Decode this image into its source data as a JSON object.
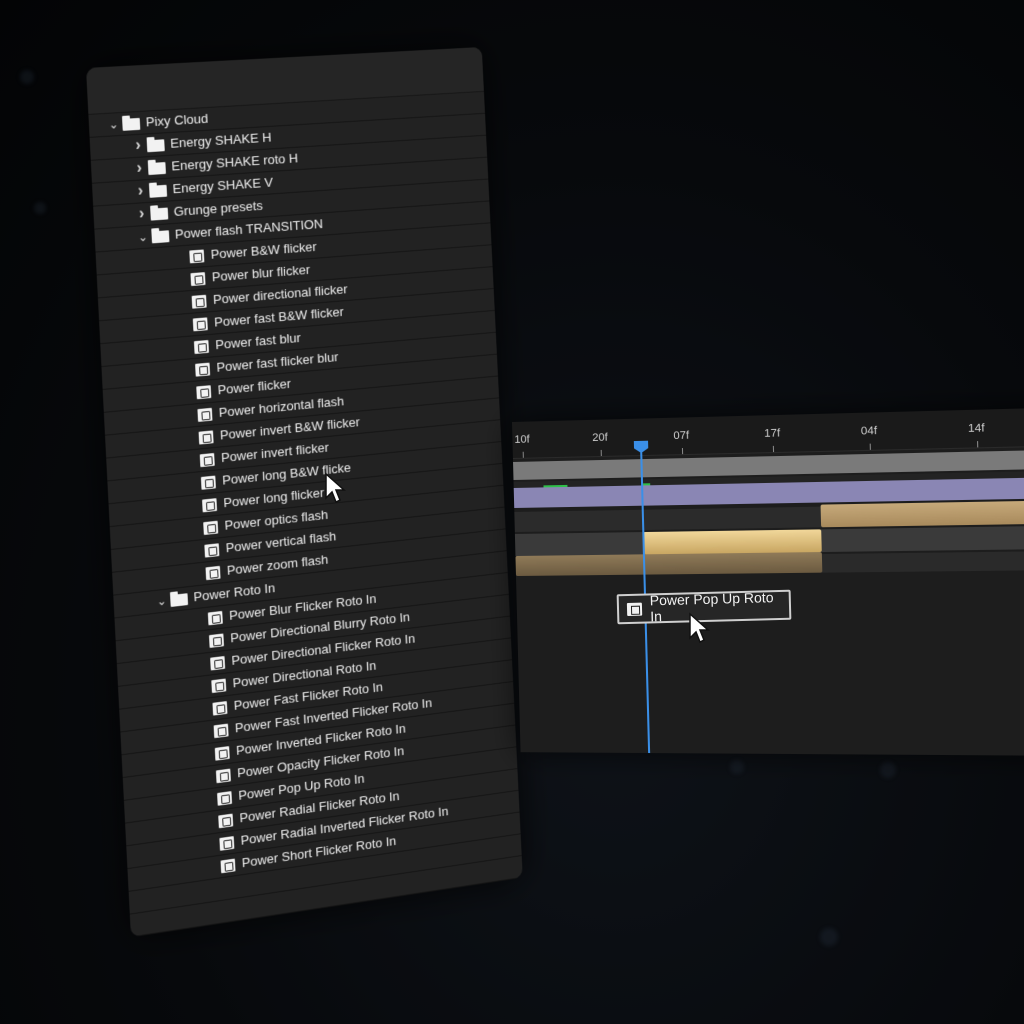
{
  "presets_panel": {
    "items": [
      {
        "label": "Pixy Cloud",
        "kind": "folder",
        "depth": 0,
        "expanded": true
      },
      {
        "label": "Energy SHAKE H",
        "kind": "folder",
        "depth": 1,
        "expanded": false
      },
      {
        "label": "Energy SHAKE roto H",
        "kind": "folder",
        "depth": 1,
        "expanded": false
      },
      {
        "label": "Energy SHAKE V",
        "kind": "folder",
        "depth": 1,
        "expanded": false
      },
      {
        "label": "Grunge presets",
        "kind": "folder",
        "depth": 1,
        "expanded": false
      },
      {
        "label": "Power flash TRANSITION",
        "kind": "folder",
        "depth": 1,
        "expanded": true
      },
      {
        "label": "Power B&W flicker",
        "kind": "preset",
        "depth": 2
      },
      {
        "label": "Power blur flicker",
        "kind": "preset",
        "depth": 2
      },
      {
        "label": "Power directional flicker",
        "kind": "preset",
        "depth": 2
      },
      {
        "label": "Power fast B&W flicker",
        "kind": "preset",
        "depth": 2
      },
      {
        "label": "Power fast blur",
        "kind": "preset",
        "depth": 2
      },
      {
        "label": "Power fast flicker blur",
        "kind": "preset",
        "depth": 2
      },
      {
        "label": "Power flicker",
        "kind": "preset",
        "depth": 2
      },
      {
        "label": "Power horizontal flash",
        "kind": "preset",
        "depth": 2
      },
      {
        "label": "Power invert B&W flicker",
        "kind": "preset",
        "depth": 2
      },
      {
        "label": "Power invert flicker",
        "kind": "preset",
        "depth": 2
      },
      {
        "label": "Power long B&W flicke",
        "kind": "preset",
        "depth": 2
      },
      {
        "label": "Power long flicker",
        "kind": "preset",
        "depth": 2
      },
      {
        "label": "Power optics flash",
        "kind": "preset",
        "depth": 2
      },
      {
        "label": "Power vertical flash",
        "kind": "preset",
        "depth": 2
      },
      {
        "label": "Power zoom flash",
        "kind": "preset",
        "depth": 2
      },
      {
        "label": "Power Roto In",
        "kind": "folder",
        "depth": 1,
        "expanded": true
      },
      {
        "label": "Power Blur Flicker Roto In",
        "kind": "preset",
        "depth": 2
      },
      {
        "label": "Power Directional Blurry Roto In",
        "kind": "preset",
        "depth": 2
      },
      {
        "label": "Power Directional Flicker Roto In",
        "kind": "preset",
        "depth": 2
      },
      {
        "label": "Power Directional Roto In",
        "kind": "preset",
        "depth": 2
      },
      {
        "label": "Power Fast Flicker Roto In",
        "kind": "preset",
        "depth": 2
      },
      {
        "label": "Power Fast Inverted Flicker Roto In",
        "kind": "preset",
        "depth": 2
      },
      {
        "label": "Power Inverted Flicker Roto In",
        "kind": "preset",
        "depth": 2
      },
      {
        "label": "Power Opacity Flicker Roto In",
        "kind": "preset",
        "depth": 2
      },
      {
        "label": "Power Pop Up Roto In",
        "kind": "preset",
        "depth": 2
      },
      {
        "label": "Power Radial Flicker Roto In",
        "kind": "preset",
        "depth": 2
      },
      {
        "label": "Power Radial Inverted Flicker Roto In",
        "kind": "preset",
        "depth": 2
      },
      {
        "label": "Power Short Flicker Roto In",
        "kind": "preset",
        "depth": 2
      }
    ],
    "icons": {
      "folder": "folder-icon",
      "preset": "animation-preset-icon",
      "collapsed": "chevron-right-icon",
      "expanded": "chevron-down-icon"
    }
  },
  "timeline": {
    "ruler_ticks": [
      "10f",
      "20f",
      "07f",
      "17f",
      "04f",
      "14f"
    ],
    "playhead_color": "#3a8fe8",
    "keyframe_color": "#2fbf4a",
    "clip_color": "#f1d79a",
    "layer_bar_color": "#8a86b4"
  },
  "drag_chip": {
    "label": "Power Pop Up Roto In",
    "icon": "animation-preset-icon"
  }
}
